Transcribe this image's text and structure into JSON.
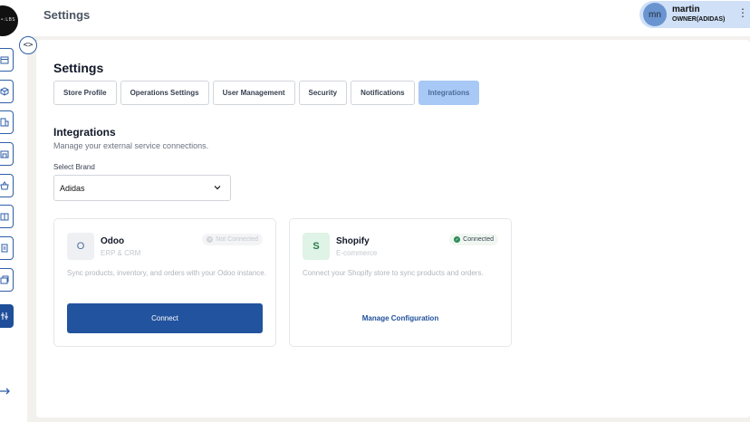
{
  "topbar": {
    "title": "Settings"
  },
  "logo": {
    "text": "•:LBS"
  },
  "user": {
    "initials": "mn",
    "name": "martin",
    "role": "OWNER(ADIDAS)"
  },
  "colors": {
    "accent": "#22539e",
    "active_tab": "#a8c8f5",
    "connected": "#2e8b57"
  },
  "sidebar": {
    "items": [
      {
        "icon": "store-icon"
      },
      {
        "icon": "box-icon"
      },
      {
        "icon": "building-icon"
      },
      {
        "icon": "shop-icon"
      },
      {
        "icon": "basket-icon"
      },
      {
        "icon": "store-front-icon"
      },
      {
        "icon": "document-icon"
      },
      {
        "icon": "layers-icon"
      },
      {
        "icon": "integrations-icon",
        "active": true
      }
    ]
  },
  "page": {
    "title": "Settings",
    "tabs": [
      {
        "label": "Store Profile"
      },
      {
        "label": "Operations Settings"
      },
      {
        "label": "User Management"
      },
      {
        "label": "Security"
      },
      {
        "label": "Notifications"
      },
      {
        "label": "Integrations",
        "active": true
      }
    ]
  },
  "integrations": {
    "title": "Integrations",
    "subtitle": "Manage your external service connections.",
    "brand_label": "Select Brand",
    "brand_value": "Adidas",
    "cards": {
      "odoo": {
        "icon_letter": "O",
        "name": "Odoo",
        "type": "ERP & CRM",
        "status": "Not Connected",
        "description": "Sync products, inventory, and orders with your Odoo instance.",
        "action": "Connect"
      },
      "shopify": {
        "icon_letter": "S",
        "name": "Shopify",
        "type": "E-commerce",
        "status": "Connected",
        "description": "Connect your Shopify store to sync products and orders.",
        "action": "Manage Configuration"
      }
    }
  }
}
